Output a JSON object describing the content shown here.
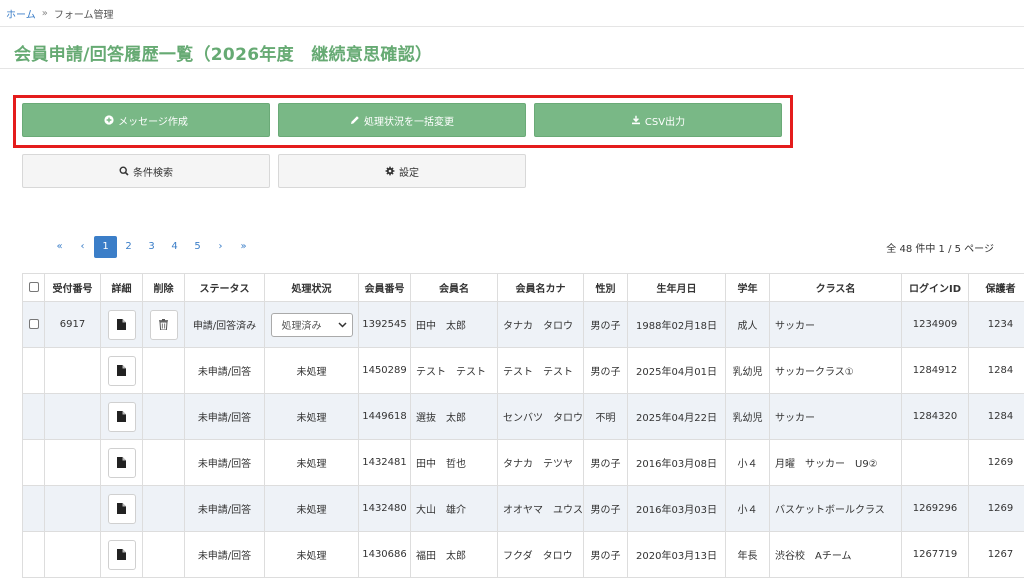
{
  "breadcrumb": {
    "home": "ホーム",
    "sep": "»",
    "current": "フォーム管理"
  },
  "page_title": "会員申請/回答履歴一覧（2026年度　継続意思確認）",
  "actions": {
    "message": "メッセージ作成",
    "bulk_change": "処理状況を一括変更",
    "csv": "CSV出力",
    "search": "条件検索",
    "settings": "設定"
  },
  "pagination": {
    "first": "«",
    "prev": "‹",
    "pages": [
      "1",
      "2",
      "3",
      "4",
      "5"
    ],
    "next": "›",
    "last": "»",
    "summary": "全 48 件中 1 / 5 ページ"
  },
  "table": {
    "headers": [
      "受付番号",
      "詳細",
      "削除",
      "ステータス",
      "処理状況",
      "会員番号",
      "会員名",
      "会員名カナ",
      "性別",
      "生年月日",
      "学年",
      "クラス名",
      "ログインID",
      "保護者"
    ],
    "rows": [
      {
        "receipt": "6917",
        "status": "申請/回答済み",
        "processing": "処理済み",
        "member_no": "1392545",
        "name": "田中　太郎",
        "kana": "タナカ　タロウ",
        "gender": "男の子",
        "birth": "1988年02月18日",
        "grade": "成人",
        "class": "サッカー",
        "login": "1234909",
        "guardian": "1234"
      },
      {
        "receipt": "",
        "status": "未申請/回答",
        "processing": "未処理",
        "member_no": "1450289",
        "name": "テスト　テスト",
        "kana": "テスト　テスト",
        "gender": "男の子",
        "birth": "2025年04月01日",
        "grade": "乳幼児",
        "class": "サッカークラス①",
        "login": "1284912",
        "guardian": "1284"
      },
      {
        "receipt": "",
        "status": "未申請/回答",
        "processing": "未処理",
        "member_no": "1449618",
        "name": "選抜　太郎",
        "kana": "センバツ　タロウ",
        "gender": "不明",
        "birth": "2025年04月22日",
        "grade": "乳幼児",
        "class": "サッカー",
        "login": "1284320",
        "guardian": "1284"
      },
      {
        "receipt": "",
        "status": "未申請/回答",
        "processing": "未処理",
        "member_no": "1432481",
        "name": "田中　哲也",
        "kana": "タナカ　テツヤ",
        "gender": "男の子",
        "birth": "2016年03月08日",
        "grade": "小４",
        "class": "月曜　サッカー　U9②",
        "login": "",
        "guardian": "1269"
      },
      {
        "receipt": "",
        "status": "未申請/回答",
        "processing": "未処理",
        "member_no": "1432480",
        "name": "大山　雄介",
        "kana": "オオヤマ　ユウスケ",
        "gender": "男の子",
        "birth": "2016年03月03日",
        "grade": "小４",
        "class": "バスケットボールクラス",
        "login": "1269296",
        "guardian": "1269"
      },
      {
        "receipt": "",
        "status": "未申請/回答",
        "processing": "未処理",
        "member_no": "1430686",
        "name": "福田　太郎",
        "kana": "フクダ　タロウ",
        "gender": "男の子",
        "birth": "2020年03月13日",
        "grade": "年長",
        "class": "渋谷校　Aチーム",
        "login": "1267719",
        "guardian": "1267"
      }
    ]
  },
  "colors": {
    "accent_green": "#79b886",
    "title_green": "#66aa73",
    "link_blue": "#3b7ec8",
    "highlight_red": "#e41c1c"
  }
}
